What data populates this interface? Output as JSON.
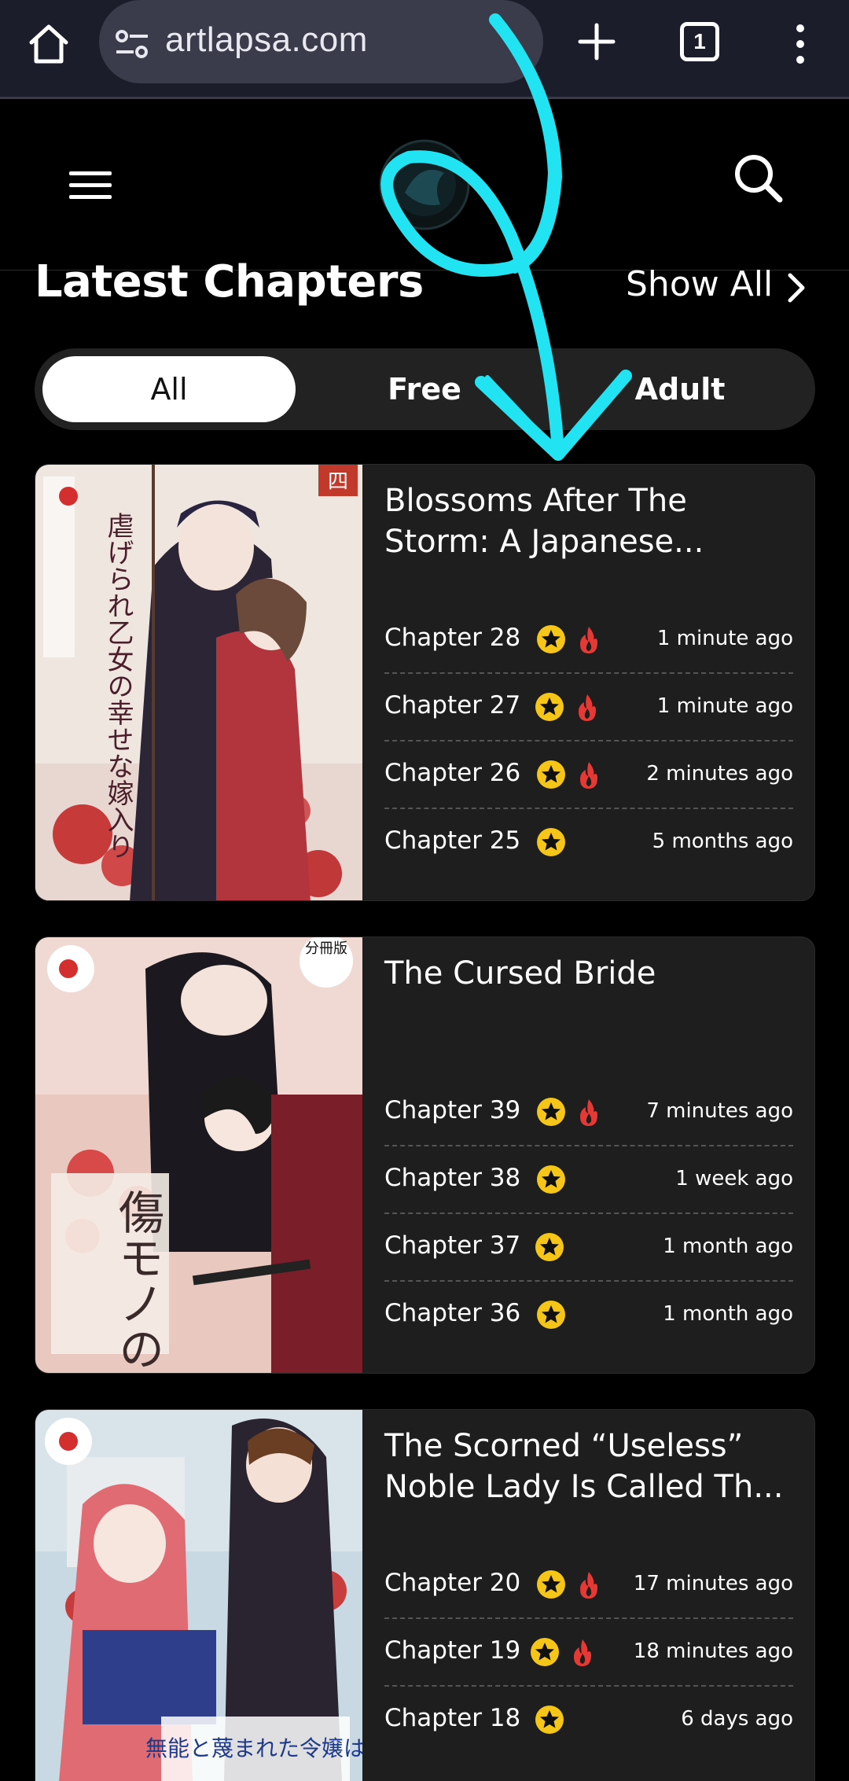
{
  "browser": {
    "url": "artlapsa.com",
    "tab_count": "1"
  },
  "section": {
    "title": "Latest Chapters",
    "show_all": "Show All"
  },
  "filters": [
    "All",
    "Free",
    "Adult"
  ],
  "active_filter": "All",
  "colors": {
    "background": "#000000",
    "card": "#1e1e1e",
    "star": "#f5c518",
    "fire": "#e53935",
    "annotation": "#22e3f2"
  },
  "cards": [
    {
      "title_line1": "Blossoms After The",
      "title_line2": "Storm: A Japanese...",
      "chapters": [
        {
          "label": "Chapter 28",
          "star": true,
          "fire": true,
          "time": "1 minute ago"
        },
        {
          "label": "Chapter 27",
          "star": true,
          "fire": true,
          "time": "1 minute ago"
        },
        {
          "label": "Chapter 26",
          "star": true,
          "fire": true,
          "time": "2 minutes ago"
        },
        {
          "label": "Chapter 25",
          "star": true,
          "fire": false,
          "time": "5 months ago"
        }
      ]
    },
    {
      "title_line1": "The Cursed Bride",
      "title_line2": "",
      "chapters": [
        {
          "label": "Chapter 39",
          "star": true,
          "fire": true,
          "time": "7 minutes ago"
        },
        {
          "label": "Chapter 38",
          "star": true,
          "fire": false,
          "time": "1 week ago"
        },
        {
          "label": "Chapter 37",
          "star": true,
          "fire": false,
          "time": "1 month ago"
        },
        {
          "label": "Chapter 36",
          "star": true,
          "fire": false,
          "time": "1 month ago"
        }
      ]
    },
    {
      "title_line1": "The Scorned “Useless”",
      "title_line2": "Noble Lady Is Called Th...",
      "chapters": [
        {
          "label": "Chapter 20",
          "star": true,
          "fire": true,
          "time": "17 minutes ago"
        },
        {
          "label": "Chapter 19",
          "star": true,
          "fire": true,
          "time": "18 minutes ago"
        },
        {
          "label": "Chapter 18",
          "star": true,
          "fire": false,
          "time": "6 days ago"
        }
      ]
    }
  ],
  "cover_texts": {
    "card1_number": "四",
    "card1_title": "虐げられ乙女の幸せな嫁入り",
    "card2_badge": "分冊版",
    "card2_title": "傷モノの花嫁",
    "card3_title": "無能と蔑まれた令嬢は"
  }
}
